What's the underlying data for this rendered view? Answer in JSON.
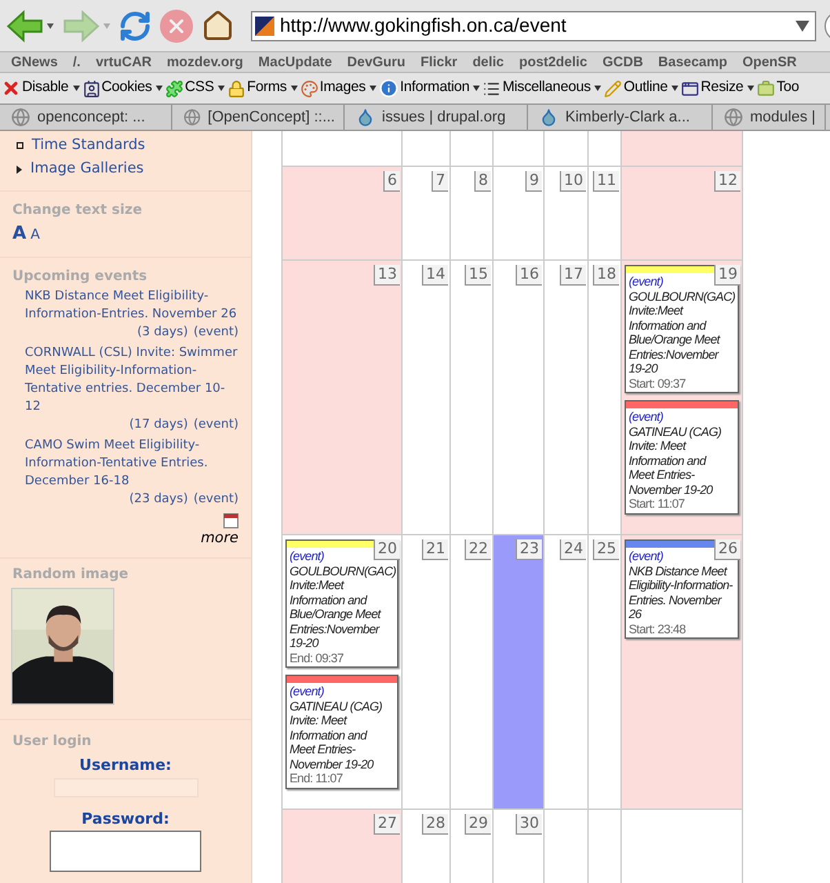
{
  "toolbar": {
    "buttons": [
      {
        "kind": "back",
        "disabled": false
      },
      {
        "kind": "forward",
        "disabled": true
      },
      {
        "kind": "reload",
        "disabled": false
      },
      {
        "kind": "stop",
        "disabled": true
      },
      {
        "kind": "home",
        "disabled": false
      }
    ],
    "url": "http://www.gokingfish.on.ca/event"
  },
  "bookmarks": [
    "GNews",
    "/.",
    "vrtuCAR",
    "mozdev.org",
    "MacUpdate",
    "DevGuru",
    "Flickr",
    "delic",
    "post2delic",
    "GCDB",
    "Basecamp",
    "OpenSR"
  ],
  "dev_toolbar": [
    {
      "label": "Disable",
      "menu": true
    },
    {
      "label": "Cookies",
      "menu": true
    },
    {
      "label": "CSS",
      "menu": true
    },
    {
      "label": "Forms",
      "menu": true
    },
    {
      "label": "Images",
      "menu": true
    },
    {
      "label": "Information",
      "menu": true
    },
    {
      "label": "Miscellaneous",
      "menu": true
    },
    {
      "label": "Outline",
      "menu": true
    },
    {
      "label": "Resize",
      "menu": true
    },
    {
      "label": "Too",
      "menu": false
    }
  ],
  "tabs": [
    {
      "title": "openconcept: ...",
      "selected": false
    },
    {
      "title": "[OpenConcept] ::...",
      "selected": false
    },
    {
      "title": "issues | drupal.org",
      "selected": false
    },
    {
      "title": "Kimberly-Clark a...",
      "selected": false
    },
    {
      "title": "modules |",
      "selected": false
    }
  ],
  "sidebar": {
    "menu": [
      {
        "label": "Time Standards",
        "kind": "leaf"
      },
      {
        "label": "Image Galleries",
        "kind": "collapsed"
      }
    ],
    "text_size": {
      "heading": "Change text size",
      "options": [
        "A",
        "A"
      ]
    },
    "upcoming": {
      "heading": "Upcoming events",
      "items": [
        {
          "title": "NKB Distance Meet Eligibility-Information-Entries. November 26",
          "countdown": "(3 days)",
          "link": "(event)"
        },
        {
          "title": "CORNWALL (CSL) Invite: Swimmer Meet Eligibility-Information-Tentative entries. December 10-12",
          "countdown": "(17 days)",
          "link": "(event)"
        },
        {
          "title": "CAMO Swim Meet Eligibility-Information-Tentative Entries. December 16-18",
          "countdown": "(23 days)",
          "link": "(event)"
        }
      ],
      "more": "more"
    },
    "random_image": {
      "heading": "Random image",
      "kind": "picture"
    },
    "login": {
      "heading": "User login",
      "username_label": "Username:",
      "password_label": "Password:"
    }
  },
  "calendar": {
    "weeks": [
      {
        "days": [
          {
            "kind": "plain"
          },
          {
            "kind": "plain"
          },
          {
            "kind": "plain"
          },
          {
            "kind": "plain"
          },
          {
            "kind": "plain"
          },
          {
            "kind": "plain"
          },
          {
            "kind": "weekend"
          }
        ]
      },
      {
        "days": [
          {
            "number": "6",
            "kind": "weekend"
          },
          {
            "number": "7",
            "kind": "plain"
          },
          {
            "number": "8",
            "kind": "plain"
          },
          {
            "number": "9",
            "kind": "plain"
          },
          {
            "number": "10",
            "kind": "plain"
          },
          {
            "number": "11",
            "kind": "plain"
          },
          {
            "number": "12",
            "kind": "weekend"
          }
        ]
      },
      {
        "days": [
          {
            "number": "13",
            "kind": "weekend"
          },
          {
            "number": "14",
            "kind": "plain"
          },
          {
            "number": "15",
            "kind": "plain"
          },
          {
            "number": "16",
            "kind": "plain"
          },
          {
            "number": "17",
            "kind": "plain"
          },
          {
            "number": "18",
            "kind": "plain"
          },
          {
            "number": "19",
            "kind": "weekend",
            "events": [
              {
                "link": "(event)",
                "title": "GOULBOURN(GAC) Invite:Meet Information and Blue/Orange Meet Entries:November 19-20",
                "time": "Start: 09:37",
                "color": "#ffff66"
              },
              {
                "link": "(event)",
                "title": "GATINEAU (CAG) Invite: Meet Information and Meet Entries-November 19-20",
                "time": "Start: 11:07",
                "color": "#ff6666"
              }
            ]
          }
        ]
      },
      {
        "days": [
          {
            "number": "20",
            "kind": "plain",
            "events": [
              {
                "link": "(event)",
                "title": "GOULBOURN(GAC) Invite:Meet Information and Blue/Orange Meet Entries:November 19-20",
                "time": "End: 09:37",
                "color": "#ffff66"
              },
              {
                "link": "(event)",
                "title": "GATINEAU (CAG) Invite: Meet Information and Meet Entries-November 19-20",
                "time": "End: 11:07",
                "color": "#ff6666"
              }
            ]
          },
          {
            "number": "21",
            "kind": "plain"
          },
          {
            "number": "22",
            "kind": "plain"
          },
          {
            "number": "23",
            "kind": "today"
          },
          {
            "number": "24",
            "kind": "plain"
          },
          {
            "number": "25",
            "kind": "plain"
          },
          {
            "number": "26",
            "kind": "weekend",
            "events": [
              {
                "link": "(event)",
                "title": "NKB Distance Meet Eligibility-Information-Entries. November 26",
                "time": "Start: 23:48",
                "color": "#6688ee"
              }
            ]
          }
        ]
      },
      {
        "days": [
          {
            "number": "27",
            "kind": "weekend"
          },
          {
            "number": "28",
            "kind": "plain"
          },
          {
            "number": "29",
            "kind": "plain"
          },
          {
            "number": "30",
            "kind": "plain"
          },
          {
            "kind": "plain"
          },
          {
            "kind": "plain"
          },
          {
            "kind": "plain"
          }
        ]
      }
    ]
  }
}
